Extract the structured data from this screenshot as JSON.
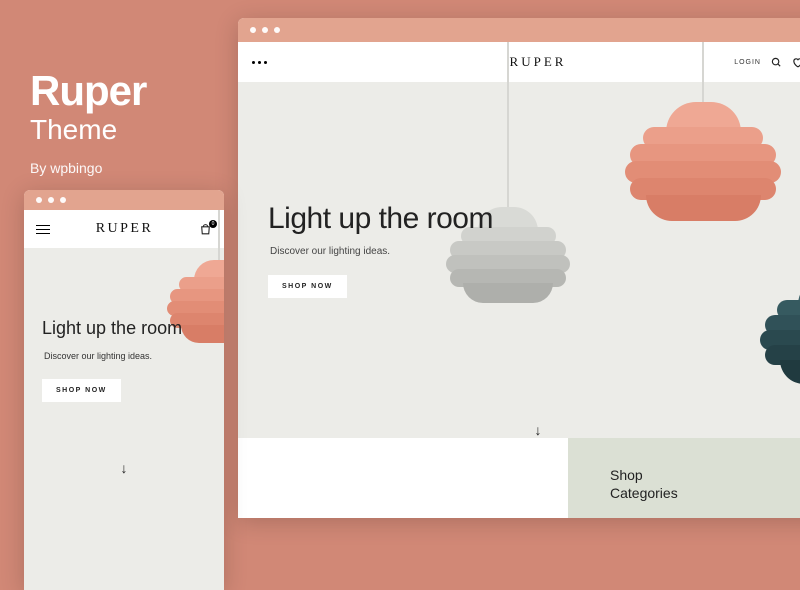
{
  "theme": {
    "name": "Ruper",
    "subtitle": "Theme",
    "author": "By wpbingo"
  },
  "brand": "RUPER",
  "header": {
    "login": "LOGIN",
    "wishlist_count": "0",
    "cart_count": "0"
  },
  "hero": {
    "headline": "Light up the room",
    "tagline": "Discover our lighting ideas.",
    "cta": "SHOP NOW"
  },
  "categories": {
    "label1": "Shop",
    "label2": "Categories"
  },
  "colors": {
    "background": "#d18876",
    "hero_bg": "#ecece8",
    "chrome": "#e2a48f",
    "coral_lamp": "#e89a85",
    "gray_lamp": "#d5d6d2",
    "teal_lamp": "#2e5157",
    "category_bg": "#dbe0d4"
  }
}
